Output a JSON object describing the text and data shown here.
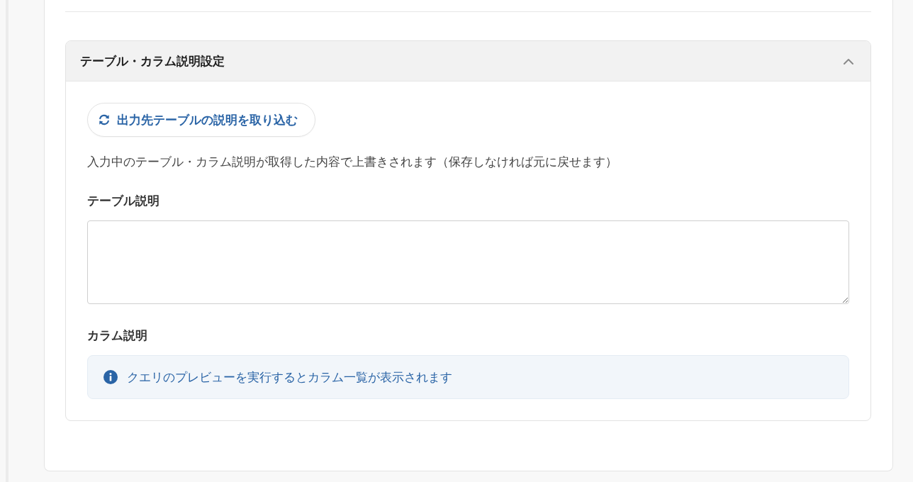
{
  "section": {
    "title": "テーブル・カラム説明設定",
    "expanded": true,
    "import_button": {
      "label": "出力先テーブルの説明を取り込む"
    },
    "note": "入力中のテーブル・カラム説明が取得した内容で上書きされます（保存しなければ元に戻せます）",
    "table_description": {
      "label": "テーブル説明"
    },
    "column_description": {
      "label": "カラム説明",
      "info": "クエリのプレビューを実行するとカラム一覧が表示されます"
    }
  }
}
